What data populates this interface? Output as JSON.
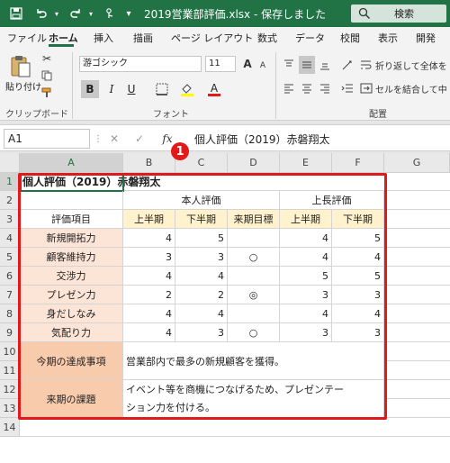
{
  "window": {
    "title": "2019営業部評価.xlsx  -  保存しました",
    "search_label": "検索"
  },
  "ribbon_tabs": [
    "ファイル",
    "ホーム",
    "挿入",
    "描画",
    "ページ レイアウト",
    "数式",
    "データ",
    "校閲",
    "表示",
    "開発"
  ],
  "ribbon": {
    "paste_label": "貼り付け",
    "clipboard_group": "クリップボード",
    "font_group": "フォント",
    "alignment_group": "配置",
    "font_name": "游ゴシック",
    "font_size": "11",
    "wrap_text": "折り返して全体を",
    "merge_center": "セルを結合して中",
    "bold": "B",
    "italic": "I",
    "underline": "U",
    "font_color_glyph": "A",
    "grow_font": "A",
    "shrink_font": "A",
    "font_color": "#e01a1a",
    "fill_color": "#ffff00"
  },
  "formula_bar": {
    "name_box": "A1",
    "fx_label": "fx",
    "content": "個人評価（2019）赤磐翔太"
  },
  "annotation": {
    "badge": "1",
    "color": "#e01a1a"
  },
  "sheet": {
    "columns": [
      "A",
      "B",
      "C",
      "D",
      "E",
      "F",
      "G"
    ],
    "rows": [
      "1",
      "2",
      "3",
      "4",
      "5",
      "6",
      "7",
      "8",
      "9",
      "10",
      "11",
      "12",
      "13",
      "14"
    ],
    "title": "個人評価（2019）赤磐翔太",
    "self_eval_header": "本人評価",
    "boss_eval_header": "上長評価",
    "item_header": "評価項目",
    "first_half": "上半期",
    "second_half": "下半期",
    "next_goal": "来期目標",
    "boss_first_half": "上半期",
    "boss_second_half": "下半期",
    "items": [
      {
        "name": "新規開拓力",
        "b": "4",
        "c": "5",
        "d": "",
        "e": "4",
        "f": "5"
      },
      {
        "name": "顧客維持力",
        "b": "3",
        "c": "3",
        "d": "○",
        "e": "4",
        "f": "4"
      },
      {
        "name": "交渉力",
        "b": "4",
        "c": "4",
        "d": "",
        "e": "5",
        "f": "5"
      },
      {
        "name": "プレゼン力",
        "b": "2",
        "c": "2",
        "d": "◎",
        "e": "3",
        "f": "3"
      },
      {
        "name": "身だしなみ",
        "b": "4",
        "c": "4",
        "d": "",
        "e": "4",
        "f": "4"
      },
      {
        "name": "気配り力",
        "b": "4",
        "c": "3",
        "d": "○",
        "e": "3",
        "f": "3"
      }
    ],
    "achievements_label": "今期の達成事項",
    "achievements_text": "営業部内で最多の新規顧客を獲得。",
    "next_issues_label": "来期の課題",
    "next_issues_line1": "イベント等を商機につなげるため、プレゼンテー",
    "next_issues_line2": "ション力を付ける。"
  }
}
